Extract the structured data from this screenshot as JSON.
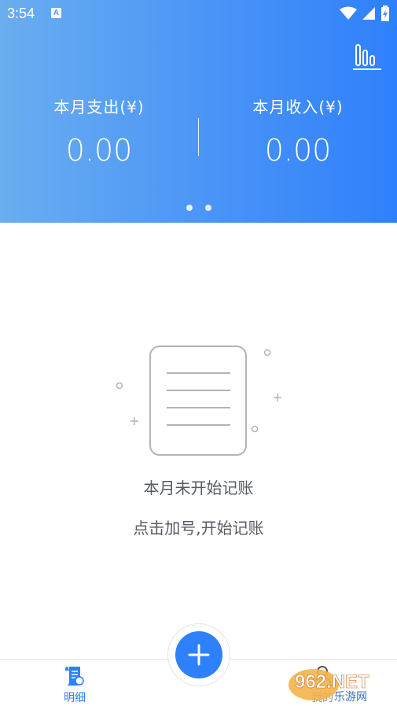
{
  "status_bar": {
    "time": "3:54",
    "notification_icon": "A"
  },
  "header": {
    "stats_icon": "bar-chart-icon",
    "expense_label": "本月支出(¥)",
    "expense_value": "0.00",
    "income_label": "本月收入(¥)",
    "income_value": "0.00",
    "page_indicator": {
      "count": 2,
      "active": 0
    }
  },
  "empty_state": {
    "illustration": "document-icon",
    "title": "本月未开始记账",
    "subtitle": "点击加号,开始记账"
  },
  "tab_bar": {
    "tabs": [
      {
        "label": "明细",
        "icon": "bill-icon",
        "active": true
      },
      {
        "label": "我的",
        "icon": "person-icon",
        "active": false
      }
    ],
    "add_button": "plus-icon"
  },
  "watermark": {
    "text": "962.NET",
    "subtext": "乐游网"
  },
  "colors": {
    "primary": "#2f80fb",
    "gradient_start": "#6aaef0",
    "text_muted": "#555a64"
  }
}
